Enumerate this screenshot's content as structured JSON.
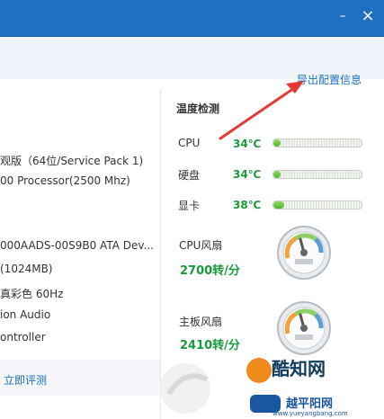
{
  "window": {
    "controls": {
      "minimize": "–",
      "close": "×"
    }
  },
  "left": {
    "specs": [
      "观版（64位/Service Pack 1)",
      "00 Processor(2500 Mhz)",
      "000AADS-00S9B0 ATA Dev...",
      "(1024MB)",
      "真彩色 60Hz",
      "ion Audio",
      "ontroller"
    ],
    "eval_link": "立即评测"
  },
  "right": {
    "export_link": "导出配置信息",
    "section_title": "温度检测",
    "temps": [
      {
        "label": "CPU",
        "value": "34℃",
        "fill": 0.08
      },
      {
        "label": "硬盘",
        "value": "34℃",
        "fill": 0.08
      },
      {
        "label": "显卡",
        "value": "38℃",
        "fill": 0.12
      }
    ],
    "fans": [
      {
        "label": "CPU风扇",
        "speed": "2700转/分"
      },
      {
        "label": "主板风扇",
        "speed": "2410转/分"
      }
    ]
  },
  "watermark": {
    "brand": "酷知网",
    "brand2": "越平阳网",
    "url": "www.yueyangbang.com"
  },
  "colors": {
    "titlebar": "#1f6fc2",
    "link": "#1a6fc0",
    "temp_value": "#1a9a3a",
    "arrow": "#e53935"
  }
}
